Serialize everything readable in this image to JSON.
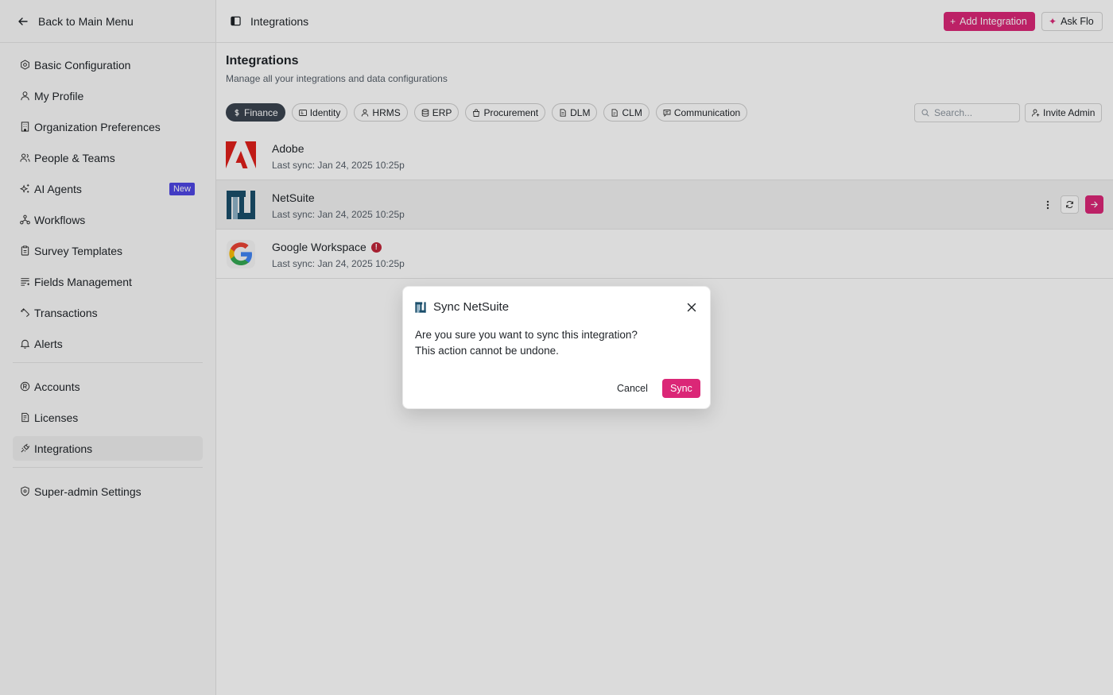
{
  "colors": {
    "accent": "#db2777",
    "badge": "#4f46e5",
    "chip_active": "#3b4450",
    "warning": "#c0263a"
  },
  "sidebar": {
    "back_label": "Back to Main Menu",
    "items": [
      {
        "label": "Basic Configuration",
        "icon": "settings-hex-icon"
      },
      {
        "label": "My Profile",
        "icon": "user-icon"
      },
      {
        "label": "Organization Preferences",
        "icon": "building-icon"
      },
      {
        "label": "People & Teams",
        "icon": "users-icon"
      },
      {
        "label": "AI Agents",
        "icon": "sparkles-icon",
        "badge": "New"
      },
      {
        "label": "Workflows",
        "icon": "workflow-icon"
      },
      {
        "label": "Survey Templates",
        "icon": "clipboard-icon"
      },
      {
        "label": "Fields Management",
        "icon": "list-icon"
      },
      {
        "label": "Transactions",
        "icon": "arrows-icon"
      },
      {
        "label": "Alerts",
        "icon": "bell-icon"
      }
    ],
    "items2": [
      {
        "label": "Accounts",
        "icon": "account-icon"
      },
      {
        "label": "Licenses",
        "icon": "license-icon"
      },
      {
        "label": "Integrations",
        "icon": "plug-icon",
        "active": true
      }
    ],
    "items3": [
      {
        "label": "Super-admin Settings",
        "icon": "shield-icon"
      }
    ]
  },
  "topbar": {
    "title": "Integrations",
    "add_label": "Add Integration",
    "ask_label": "Ask Flo"
  },
  "main": {
    "title": "Integrations",
    "subtitle": "Manage all your integrations and data configurations",
    "chips": [
      "Finance",
      "Identity",
      "HRMS",
      "ERP",
      "Procurement",
      "DLM",
      "CLM",
      "Communication"
    ],
    "active_chip": "Finance",
    "search_placeholder": "Search...",
    "invite_label": "Invite Admin",
    "integrations": [
      {
        "name": "Adobe",
        "sync": "Last sync: Jan 24, 2025 10:25p"
      },
      {
        "name": "NetSuite",
        "sync": "Last sync: Jan 24, 2025 10:25p"
      },
      {
        "name": "Google Workspace",
        "sync": "Last sync: Jan 24, 2025 10:25p",
        "warning": "!"
      }
    ]
  },
  "modal": {
    "title": "Sync NetSuite",
    "line1": "Are you sure you want to sync this integration?",
    "line2": "This action cannot be undone.",
    "cancel": "Cancel",
    "confirm": "Sync"
  }
}
